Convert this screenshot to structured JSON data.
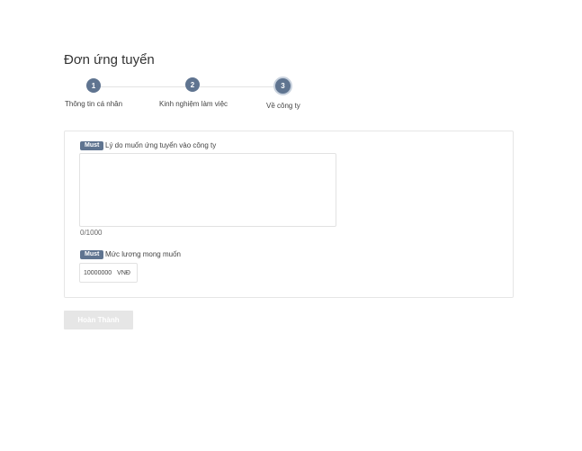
{
  "page": {
    "title": "Đơn ứng tuyển"
  },
  "stepper": {
    "steps": [
      {
        "number": "1",
        "label": "Thông tin cá nhân"
      },
      {
        "number": "2",
        "label": "Kinh nghiệm làm việc"
      },
      {
        "number": "3",
        "label": "Về công ty"
      }
    ]
  },
  "form": {
    "reason": {
      "badge": "Must",
      "label": "Lý do muốn ứng tuyển vào công ty",
      "value": "",
      "counter": "0/1000"
    },
    "salary": {
      "badge": "Must",
      "label": "Mức lương mong muốn",
      "value": "10000000",
      "unit": "VNĐ"
    }
  },
  "actions": {
    "submit_label": "Hoàn Thành"
  },
  "colors": {
    "accent": "#5f7490",
    "disabled": "#e6e6e6",
    "border": "#e6e6e6"
  }
}
